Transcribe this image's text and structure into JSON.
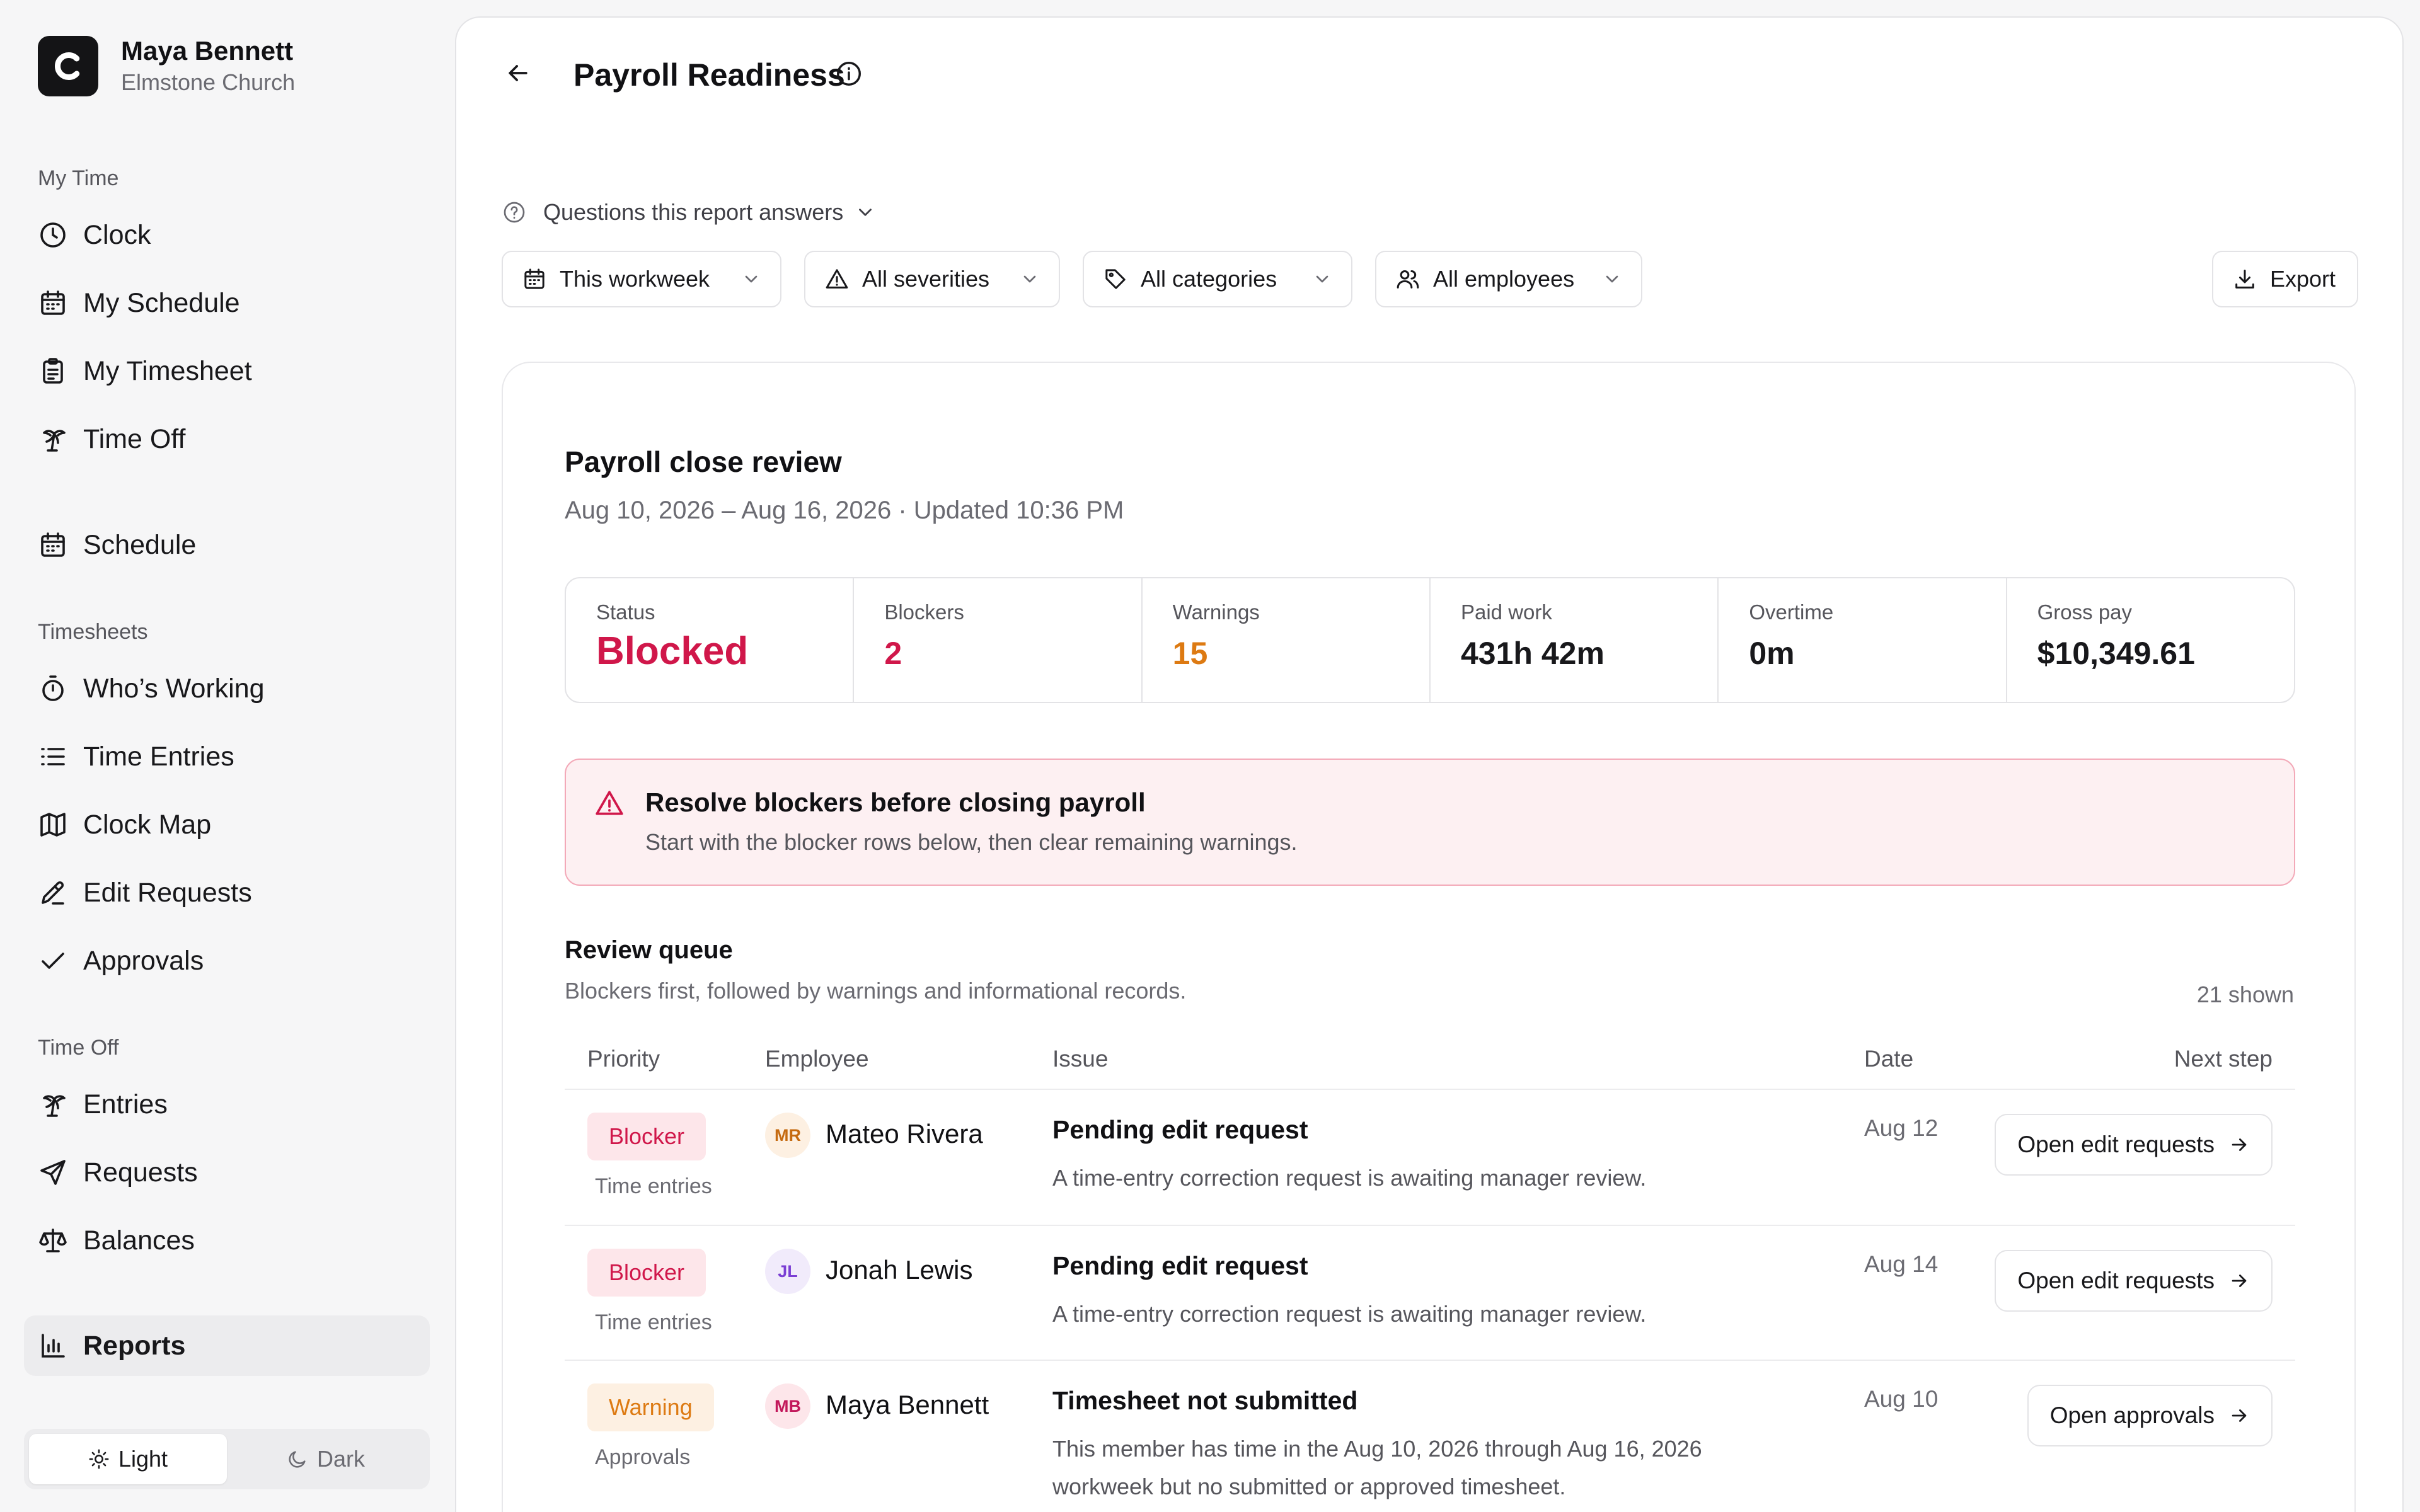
{
  "user": {
    "name": "Maya Bennett",
    "org": "Elmstone Church",
    "logo_letter": "C"
  },
  "sidebar": {
    "sections": [
      {
        "label": "My Time"
      },
      {
        "label": "Timesheets"
      },
      {
        "label": "Time Off"
      }
    ],
    "items": [
      {
        "label": "Clock",
        "icon": "clock-icon"
      },
      {
        "label": "My Schedule",
        "icon": "calendar-icon"
      },
      {
        "label": "My Timesheet",
        "icon": "clipboard-icon"
      },
      {
        "label": "Time Off",
        "icon": "palm-tree-icon"
      },
      {
        "label": "Schedule",
        "icon": "calendar-icon"
      },
      {
        "label": "Who’s Working",
        "icon": "stopwatch-icon"
      },
      {
        "label": "Time Entries",
        "icon": "list-icon"
      },
      {
        "label": "Clock Map",
        "icon": "map-icon"
      },
      {
        "label": "Edit Requests",
        "icon": "pencil-icon"
      },
      {
        "label": "Approvals",
        "icon": "check-icon"
      },
      {
        "label": "Entries",
        "icon": "palm-tree-icon"
      },
      {
        "label": "Requests",
        "icon": "send-icon"
      },
      {
        "label": "Balances",
        "icon": "scale-icon"
      },
      {
        "label": "Reports",
        "icon": "bar-chart-icon"
      }
    ],
    "active_item": "Reports",
    "theme": {
      "light": "Light",
      "dark": "Dark",
      "selected": "Light"
    }
  },
  "header": {
    "title": "Payroll Readiness"
  },
  "questions_label": "Questions this report answers",
  "filters": {
    "period": "This workweek",
    "severity": "All severities",
    "category": "All categories",
    "employees": "All employees",
    "export": "Export"
  },
  "review": {
    "title": "Payroll close review",
    "subtitle": "Aug 10, 2026 – Aug 16, 2026 · Updated 10:36 PM",
    "stats": {
      "status": {
        "label": "Status",
        "value": "Blocked"
      },
      "blockers": {
        "label": "Blockers",
        "value": "2"
      },
      "warnings": {
        "label": "Warnings",
        "value": "15"
      },
      "paid_work": {
        "label": "Paid work",
        "value": "431h 42m"
      },
      "overtime": {
        "label": "Overtime",
        "value": "0m"
      },
      "gross_pay": {
        "label": "Gross pay",
        "value": "$10,349.61"
      }
    },
    "alert": {
      "title": "Resolve blockers before closing payroll",
      "text": "Start with the blocker rows below, then clear remaining warnings."
    }
  },
  "queue": {
    "title": "Review queue",
    "subtitle": "Blockers first, followed by warnings and informational records.",
    "count": "21 shown",
    "columns": {
      "priority": "Priority",
      "employee": "Employee",
      "issue": "Issue",
      "date": "Date",
      "next": "Next step"
    },
    "rows": [
      {
        "priority": "Blocker",
        "category": "Time entries",
        "initials": "MR",
        "employee": "Mateo Rivera",
        "issue": "Pending edit request",
        "description": "A time-entry correction request is awaiting manager review.",
        "date": "Aug 12",
        "action": "Open edit requests"
      },
      {
        "priority": "Blocker",
        "category": "Time entries",
        "initials": "JL",
        "employee": "Jonah Lewis",
        "issue": "Pending edit request",
        "description": "A time-entry correction request is awaiting manager review.",
        "date": "Aug 14",
        "action": "Open edit requests"
      },
      {
        "priority": "Warning",
        "category": "Approvals",
        "initials": "MB",
        "employee": "Maya Bennett",
        "issue": "Timesheet not submitted",
        "description": "This member has time in the Aug 10, 2026 through Aug 16, 2026 workweek but no submitted or approved timesheet.",
        "date": "Aug 10",
        "action": "Open approvals"
      }
    ]
  },
  "colors": {
    "blocker": "#d0174a",
    "warning": "#dd7a12",
    "alert_bg": "#fdf0f2"
  }
}
